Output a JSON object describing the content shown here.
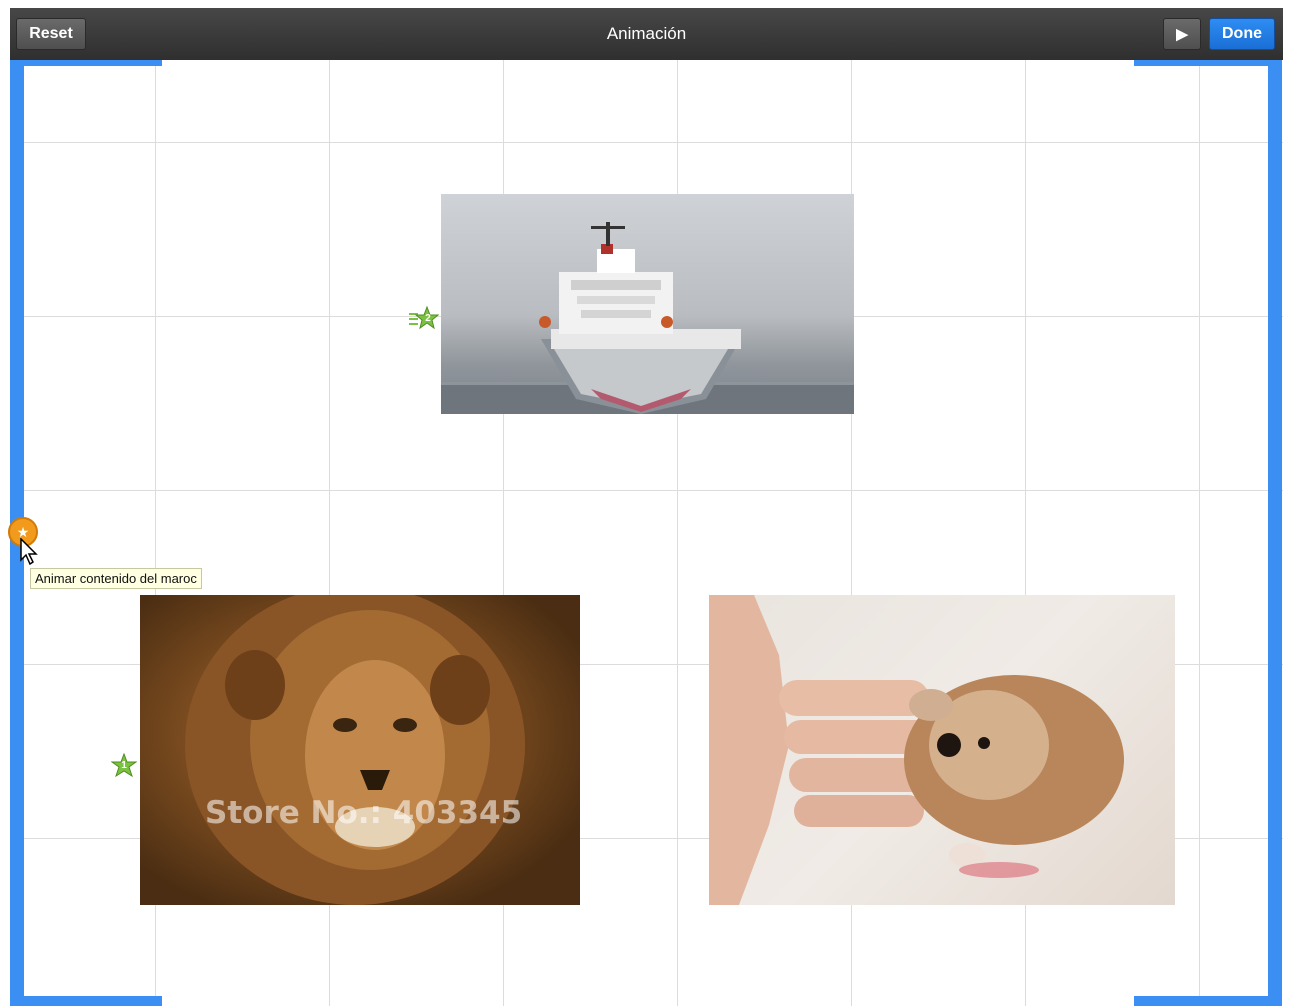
{
  "toolbar": {
    "title": "Animación",
    "reset_label": "Reset",
    "play_label": "▶",
    "done_label": "Done"
  },
  "badges": {
    "ship_order": "2",
    "lion_order": "1",
    "handle_star": "★"
  },
  "tooltip": {
    "text": "Animar contenido del maroc"
  },
  "images": {
    "lion_watermark": "Store No.: 403345"
  },
  "colors": {
    "toolbar": "#3a3a3a",
    "frame": "#3b8ef2",
    "done_button": "#1f78e0",
    "badge_green": "#7cc242",
    "handle_orange": "#f29a1b",
    "tooltip_bg": "#ffffe1"
  },
  "icons": {
    "play": "play-icon",
    "animation_badge": "star-icon",
    "handle": "orange-star-handle-icon",
    "cursor": "mouse-pointer-icon"
  }
}
